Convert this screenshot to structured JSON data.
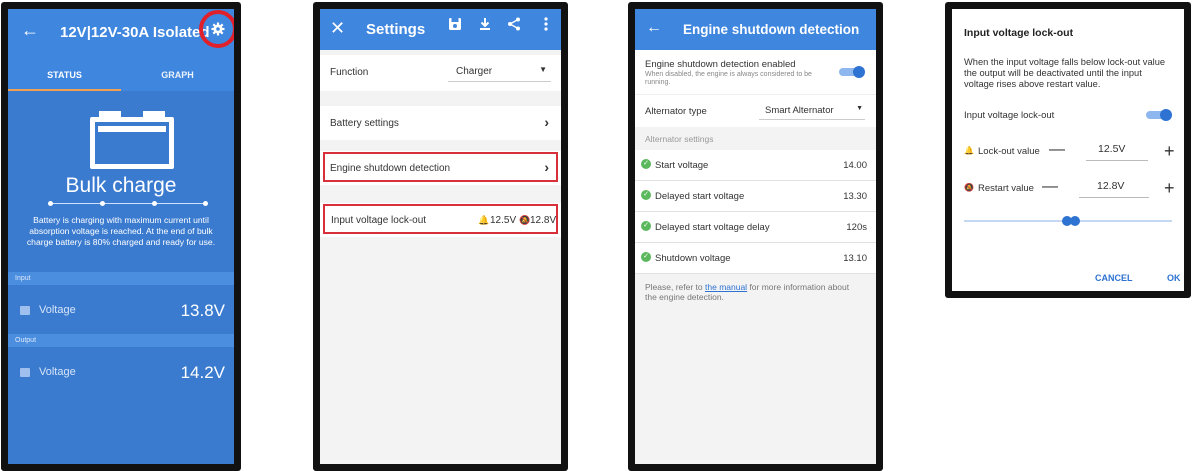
{
  "screen1": {
    "title": "12V|12V-30A Isolated",
    "tabs": [
      "STATUS",
      "GRAPH"
    ],
    "state": "Bulk charge",
    "description": "Battery is charging with maximum current until absorption voltage is reached. At the end of bulk charge battery is 80% charged and ready for use.",
    "input_header": "Input",
    "input_label": "Voltage",
    "input_value": "13.8V",
    "output_header": "Output",
    "output_label": "Voltage",
    "output_value": "14.2V"
  },
  "screen2": {
    "title": "Settings",
    "function_label": "Function",
    "function_value": "Charger",
    "battery_settings": "Battery settings",
    "engine_shutdown": "Engine shutdown detection",
    "lockout_label": "Input voltage lock-out",
    "lockout_value": "12.5V",
    "restart_value": "12.8V"
  },
  "screen3": {
    "title": "Engine shutdown detection",
    "enabled_label": "Engine shutdown detection enabled",
    "enabled_hint": "When disabled, the engine is always considered to be running.",
    "alternator_label": "Alternator type",
    "alternator_value": "Smart Alternator",
    "section": "Alternator settings",
    "rows": [
      {
        "label": "Start voltage",
        "value": "14.00"
      },
      {
        "label": "Delayed start voltage",
        "value": "13.30"
      },
      {
        "label": "Delayed start voltage delay",
        "value": "120s"
      },
      {
        "label": "Shutdown voltage",
        "value": "13.10"
      }
    ],
    "note_pre": "Please, refer to ",
    "note_link": "the manual",
    "note_post": " for more information about the engine detection."
  },
  "dialog": {
    "title": "Input voltage lock-out",
    "description": "When the input voltage falls below lock-out value the output will be deactivated until the input voltage rises above restart value.",
    "toggle_label": "Input voltage lock-out",
    "lockout_label": "Lock-out value",
    "lockout_value": "12.5V",
    "restart_label": "Restart value",
    "restart_value": "12.8V",
    "cancel": "CANCEL",
    "ok": "OK"
  },
  "colors": {
    "header_blue": "#3f86de",
    "accent_blue": "#2e73d2",
    "highlight_red": "#d8303a"
  }
}
